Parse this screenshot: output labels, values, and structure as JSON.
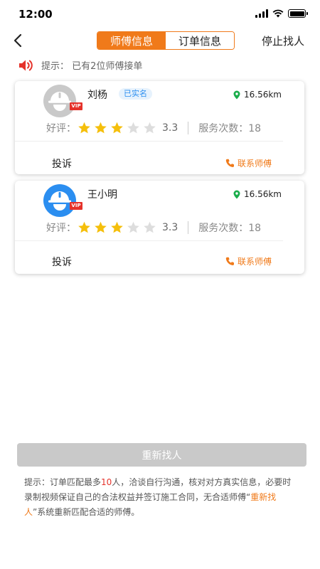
{
  "status_bar": {
    "time": "12:00",
    "icons": [
      "signal-icon",
      "wifi-icon",
      "battery-icon"
    ]
  },
  "nav": {
    "back_icon": "chevron-left-icon",
    "tabs": [
      {
        "label": "师傅信息",
        "active": true
      },
      {
        "label": "订单信息",
        "active": false
      }
    ],
    "stop_label": "停止找人"
  },
  "tip": {
    "icon": "speaker-icon",
    "text": "提示：  已有2位师傅接单"
  },
  "masters": [
    {
      "name": "刘杨",
      "avatar_color": "#c9c9c9",
      "vip": "VIP",
      "verified_label": "已实名",
      "distance": "16.56km",
      "rating_label": "好评：",
      "stars_filled": 3,
      "stars_total": 5,
      "rating_value": "3.3",
      "service_label": "服务次数：18",
      "complain_label": "投诉",
      "contact_label": "联系师傅"
    },
    {
      "name": "王小明",
      "avatar_color": "#2b8ef0",
      "vip": "VIP",
      "verified_label": "",
      "distance": "16.56km",
      "rating_label": "好评：",
      "stars_filled": 3,
      "stars_total": 5,
      "rating_value": "3.3",
      "service_label": "服务次数：18",
      "complain_label": "投诉",
      "contact_label": "联系师傅"
    }
  ],
  "refind_button": "重新找人",
  "bottom_tip": {
    "p1": "提示：订单匹配最多",
    "max_count": "10",
    "p2": "人，洽谈自行沟通，核对对方真实信息，必要时录制视频保证自己的合法权益并签订施工合同，无合适师傅“",
    "link": "重新找人",
    "p3": "”系统重新匹配合适的师傅。"
  },
  "colors": {
    "accent": "#f07a1a",
    "star": "#f5bf0b",
    "star_empty": "#dddddd",
    "red": "#e5322a",
    "location": "#1aad4b"
  }
}
